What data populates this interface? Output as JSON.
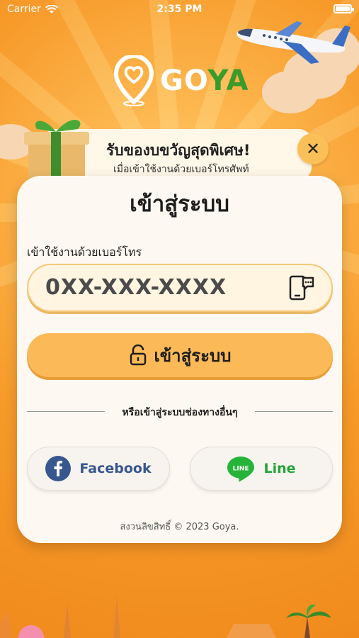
{
  "status_bar": {
    "carrier": "Carrier",
    "time": "2:35 PM"
  },
  "logo": {
    "text_go": "GO",
    "text_ya": "YA"
  },
  "banner": {
    "title": "รับของบขวัญสุดพิเศษ!",
    "subtitle": "เมื่อเข้าใช้งานด้วยเบอร์โทรศัพท์"
  },
  "login": {
    "title": "เข้าสู่ระบบ",
    "phone_label": "เข้าใช้งานด้วยเบอร์โทร",
    "phone_placeholder": "0XX-XXX-XXXX",
    "submit_label": "เข้าสู่ระบบ",
    "divider_text": "หรือเข้าสู่ระบบช่องทางอื่นๆ",
    "facebook_label": "Facebook",
    "line_label": "Line",
    "line_badge": "LINE",
    "copyright": "สงวนลิขสิทธิ์ © 2023 Goya."
  },
  "colors": {
    "primary": "#fbb958",
    "background": "#f79a2a",
    "card": "#fdf8f1",
    "facebook": "#37578f",
    "line": "#25a33a"
  }
}
